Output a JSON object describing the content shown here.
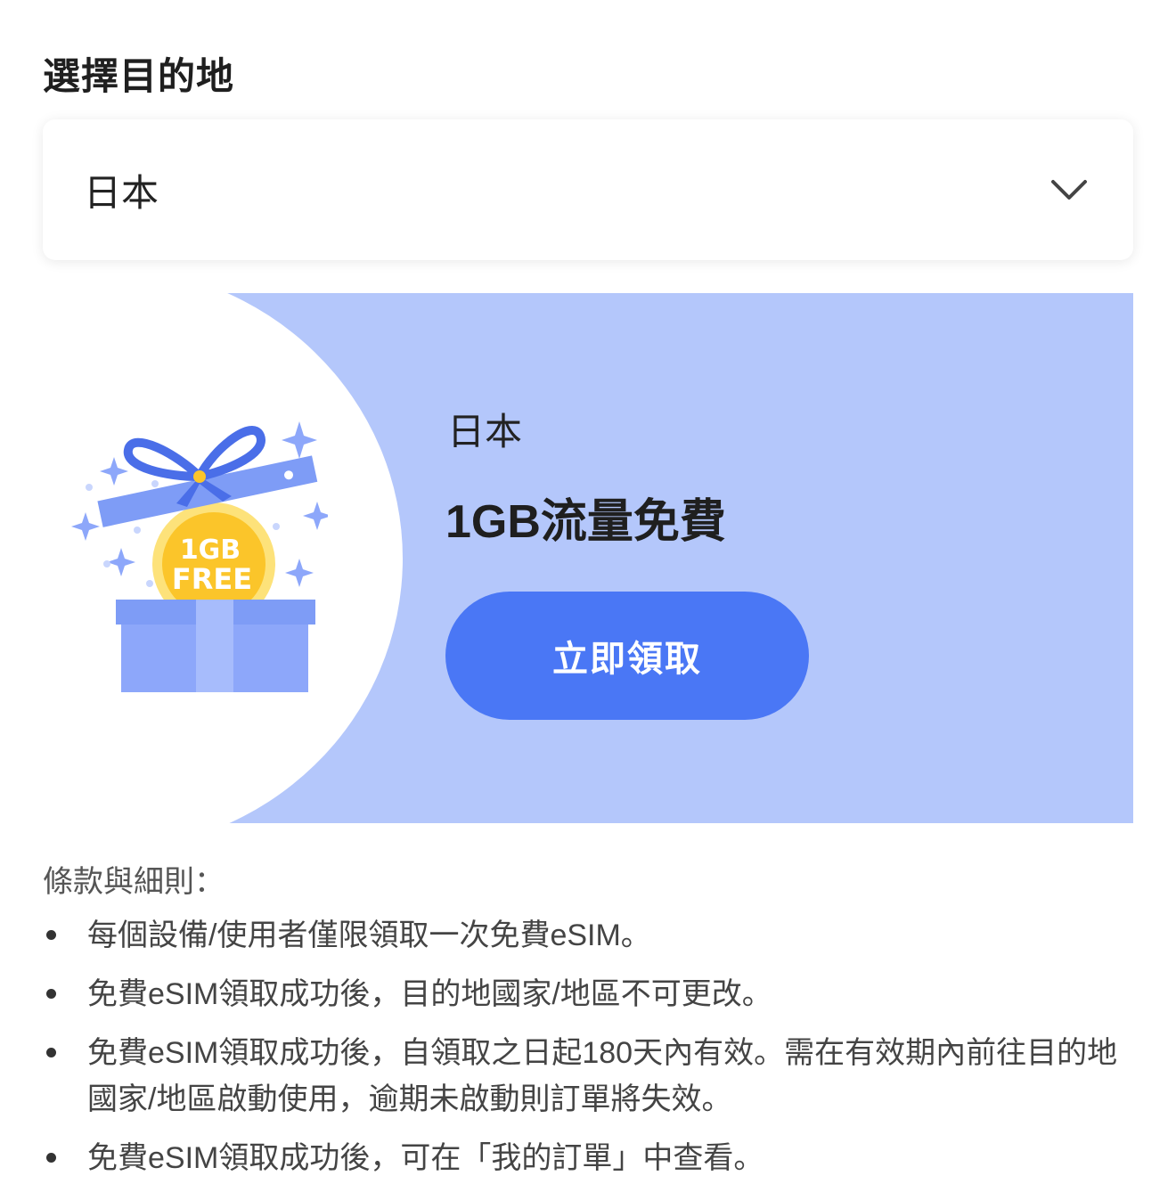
{
  "destination": {
    "title": "選擇目的地",
    "selected": "日本",
    "dropdown_icon": "chevron-down-icon"
  },
  "banner": {
    "illustration": {
      "badge_line1": "1GB",
      "badge_line2": "FREE"
    },
    "country": "日本",
    "offer": "1GB流量免費",
    "button_label": "立即領取"
  },
  "terms": {
    "title": "條款與細則：",
    "items": [
      "每個設備/使用者僅限領取一次免費eSIM。",
      "免費eSIM領取成功後，目的地國家/地區不可更改。",
      "免費eSIM領取成功後，自領取之日起180天內有效。需在有效期內前往目的地國家/地區啟動使用，逾期未啟動則訂單將失效。",
      "免費eSIM領取成功後，可在「我的訂單」中查看。"
    ]
  },
  "colors": {
    "banner_background": "#b4c7fb",
    "button": "#4a77f5",
    "gift_box": "#8da7fa",
    "ribbon": "#4a6ee8",
    "coin": "#fbc52a"
  }
}
